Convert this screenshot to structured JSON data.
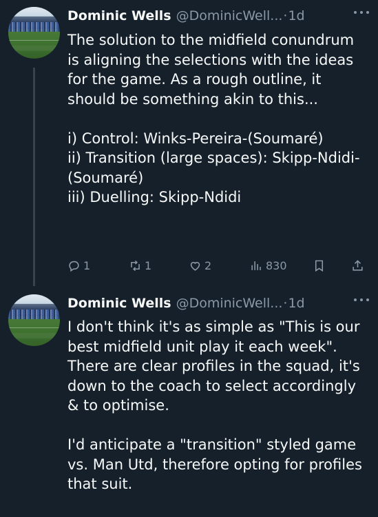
{
  "tweets": [
    {
      "author": {
        "display_name": "Dominic Wells",
        "handle": "@DominicWell...",
        "avatar": "avatar-stadium"
      },
      "separator": "·",
      "time": "1d",
      "text": "The solution to the midfield conundrum is aligning the selections with the ideas for the game. As a rough outline, it should be something akin to this...\n\ni) Control: Winks-Pereira-(Soumaré)\nii) Transition (large spaces): Skipp-Ndidi-(Soumaré)\niii) Duelling: Skipp-Ndidi",
      "actions": {
        "replies": "1",
        "reposts": "1",
        "likes": "2",
        "views": "830"
      }
    },
    {
      "author": {
        "display_name": "Dominic Wells",
        "handle": "@DominicWell...",
        "avatar": "avatar-stadium"
      },
      "separator": "·",
      "time": "1d",
      "text": "I don't think it's as simple as \"This is our best midfield unit play it each week\". There are clear profiles in the squad, it's down to the coach to select accordingly & to optimise.\n\nI'd anticipate a \"transition\" styled game vs. Man Utd, therefore opting for profiles that suit."
    }
  ],
  "icons": {
    "reply": "reply-icon",
    "repost": "repost-icon",
    "like": "like-icon",
    "views": "views-icon",
    "bookmark": "bookmark-icon",
    "share": "share-icon",
    "more": "more-icon"
  },
  "colors": {
    "background": "#15202b",
    "text": "#f7f9f9",
    "secondary": "#8b98a5",
    "thread_line": "#38444d"
  }
}
